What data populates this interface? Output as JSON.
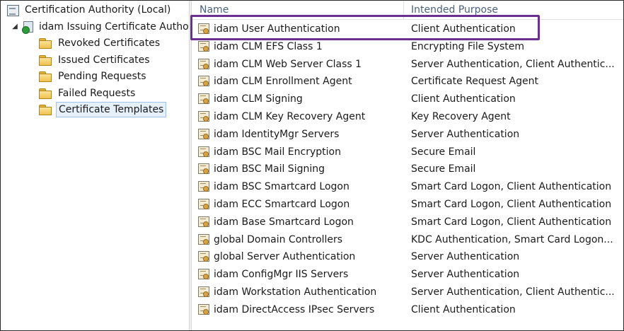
{
  "tree": {
    "root_label": "Certification Authority (Local)",
    "ca_label": "idam Issuing Certificate Authority",
    "expander_glyph": "◢",
    "folders": [
      {
        "label": "Revoked Certificates",
        "selected": false
      },
      {
        "label": "Issued Certificates",
        "selected": false
      },
      {
        "label": "Pending Requests",
        "selected": false
      },
      {
        "label": "Failed Requests",
        "selected": false
      },
      {
        "label": "Certificate Templates",
        "selected": true
      }
    ]
  },
  "list": {
    "columns": {
      "name": "Name",
      "purpose": "Intended Purpose"
    },
    "rows": [
      {
        "name": "idam User Authentication",
        "purpose": "Client Authentication",
        "highlighted": true
      },
      {
        "name": "idam CLM EFS Class 1",
        "purpose": "Encrypting File System"
      },
      {
        "name": "idam CLM Web Server Class 1",
        "purpose": "Server Authentication, Client Authentic..."
      },
      {
        "name": "idam CLM Enrollment Agent",
        "purpose": "Certificate Request Agent"
      },
      {
        "name": "idam CLM Signing",
        "purpose": "Client Authentication"
      },
      {
        "name": "idam CLM Key Recovery Agent",
        "purpose": "Key Recovery Agent"
      },
      {
        "name": "idam IdentityMgr Servers",
        "purpose": "Server Authentication"
      },
      {
        "name": "idam BSC Mail Encryption",
        "purpose": "Secure Email"
      },
      {
        "name": "idam BSC Mail Signing",
        "purpose": "Secure Email"
      },
      {
        "name": "idam BSC Smartcard Logon",
        "purpose": "Smart Card Logon, Client Authentication"
      },
      {
        "name": "idam ECC Smartcard Logon",
        "purpose": "Smart Card Logon, Client Authentication"
      },
      {
        "name": "idam Base Smartcard Logon",
        "purpose": "Smart Card Logon, Client Authentication"
      },
      {
        "name": "global Domain Controllers",
        "purpose": "KDC Authentication, Smart Card Logon..."
      },
      {
        "name": "global Server Authentication",
        "purpose": "Server Authentication"
      },
      {
        "name": "idam ConfigMgr IIS Servers",
        "purpose": "Server Authentication"
      },
      {
        "name": "idam Workstation Authentication",
        "purpose": "Server Authentication, Client Authentic..."
      },
      {
        "name": "idam DirectAccess IPsec Servers",
        "purpose": "Client Authentication"
      }
    ]
  },
  "colors": {
    "highlight_border": "#6a2f8f",
    "selection_bg": "#e5f0fb",
    "header_text": "#4c607a"
  },
  "icons": {
    "root": "certificate-store-icon",
    "ca": "ca-server-icon",
    "folder": "folder-icon",
    "template": "certificate-template-icon"
  }
}
